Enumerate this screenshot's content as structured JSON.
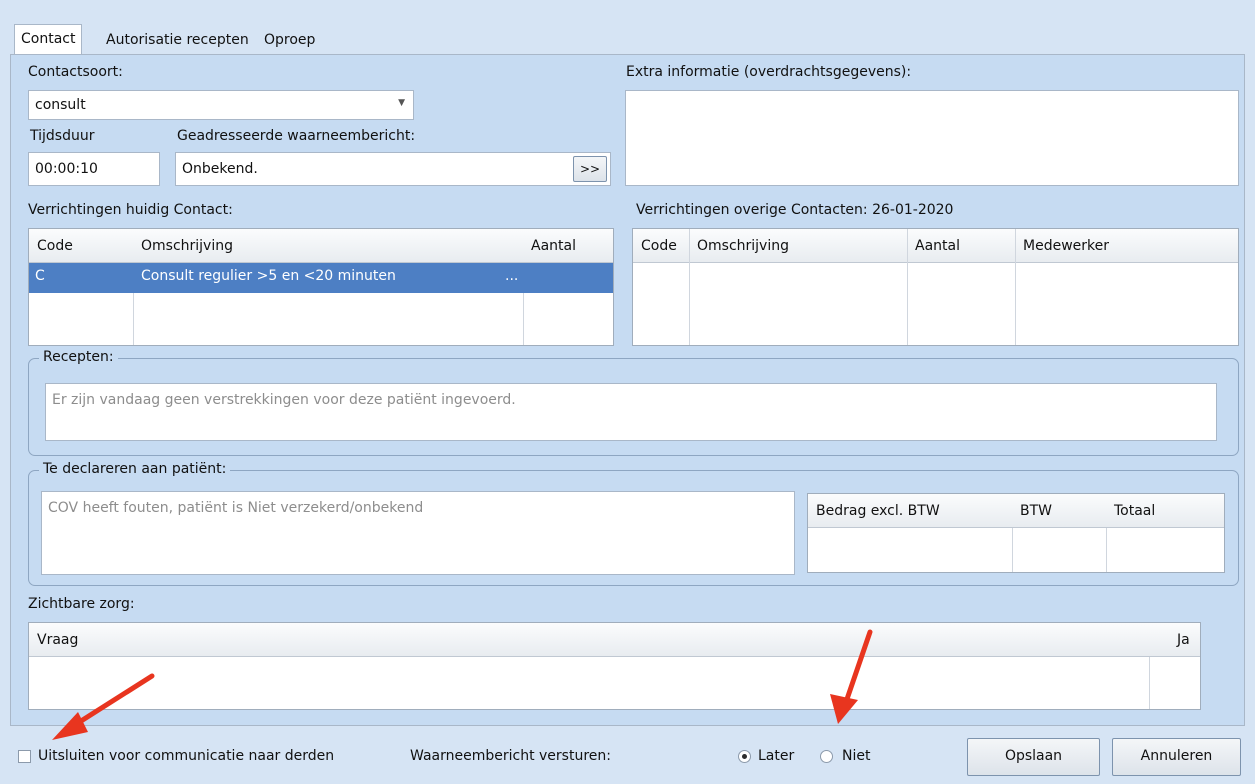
{
  "tabs": [
    "Contact",
    "Autorisatie recepten",
    "Oproep"
  ],
  "contactsoort": {
    "label": "Contactsoort:",
    "value": "consult"
  },
  "tijdsduur": {
    "label": "Tijdsduur",
    "value": "00:00:10"
  },
  "geadresseerde": {
    "label": "Geadresseerde waarneembericht:",
    "value": "Onbekend.",
    "button": ">>"
  },
  "extra_info": {
    "label": "Extra informatie (overdrachtsgegevens):",
    "value": ""
  },
  "verrichtingen_huidig": {
    "label": "Verrichtingen huidig Contact:",
    "columns": [
      "Code",
      "Omschrijving",
      "Aantal"
    ],
    "rows": [
      {
        "code": "C",
        "omschrijving": "Consult regulier >5 en <20 minuten",
        "ellipsis": "...",
        "aantal": ""
      }
    ]
  },
  "verrichtingen_overige": {
    "label": "Verrichtingen overige Contacten: 26-01-2020",
    "columns": [
      "Code",
      "Omschrijving",
      "Aantal",
      "Medewerker"
    ]
  },
  "recepten": {
    "legend": "Recepten:",
    "text": "Er zijn vandaag geen verstrekkingen voor deze patiënt ingevoerd."
  },
  "declareren": {
    "legend": "Te declareren aan patiënt:",
    "text": "COV heeft fouten, patiënt is Niet verzekerd/onbekend",
    "columns": [
      "Bedrag excl. BTW",
      "BTW",
      "Totaal"
    ]
  },
  "zichtbare_zorg": {
    "label": "Zichtbare zorg:",
    "columns": [
      "Vraag",
      "Ja"
    ]
  },
  "footer": {
    "uitsluiten_label": "Uitsluiten voor communicatie naar derden",
    "waarneembericht_label": "Waarneembericht versturen:",
    "radio_later": "Later",
    "radio_niet": "Niet",
    "selected": "Later",
    "save_label": "Opslaan",
    "cancel_label": "Annuleren"
  },
  "colors": {
    "selection": "#4d7fc4",
    "arrow": "#e8351f",
    "panel": "#c6dbf2"
  },
  "icons": [
    "dropdown-arrow-icon",
    "annotation-arrow-icon"
  ]
}
